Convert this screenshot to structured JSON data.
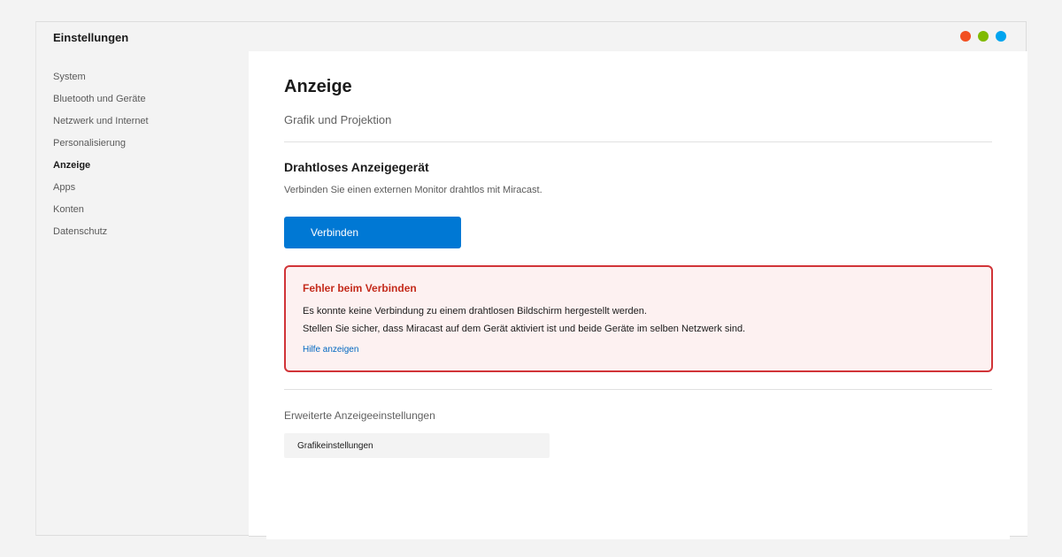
{
  "window": {
    "title": "Einstellungen",
    "controls": [
      {
        "name": "close",
        "color": "#f25022"
      },
      {
        "name": "minimize",
        "color": "#7fba00"
      },
      {
        "name": "maximize",
        "color": "#00a4ef"
      }
    ]
  },
  "sidebar": {
    "items": [
      {
        "label": "System",
        "active": false
      },
      {
        "label": "Bluetooth und Geräte",
        "active": false
      },
      {
        "label": "Netzwerk und Internet",
        "active": false
      },
      {
        "label": "Personalisierung",
        "active": false
      },
      {
        "label": "Anzeige",
        "active": true
      },
      {
        "label": "Apps",
        "active": false
      },
      {
        "label": "Konten",
        "active": false
      },
      {
        "label": "Datenschutz",
        "active": false
      }
    ]
  },
  "main": {
    "title": "Anzeige",
    "subtitle": "Grafik und Projektion",
    "wireless": {
      "title": "Drahtloses Anzeigegerät",
      "description": "Verbinden Sie einen externen Monitor drahtlos mit Miracast.",
      "connect_label": "Verbinden"
    },
    "error": {
      "title": "Fehler beim Verbinden",
      "line1": "Es konnte keine Verbindung zu einem drahtlosen Bildschirm hergestellt werden.",
      "line2": "Stellen Sie sicher, dass Miracast auf dem Gerät aktiviert ist und beide Geräte im selben Netzwerk sind.",
      "help_link": "Hilfe anzeigen"
    },
    "advanced": {
      "title": "Erweiterte Anzeigeeinstellungen",
      "graphics_label": "Grafikeinstellungen"
    }
  },
  "colors": {
    "accent": "#0078d4",
    "error_border": "#d13438",
    "error_text": "#c42b1c",
    "error_background": "#fdf1f1",
    "link": "#0067c0"
  }
}
